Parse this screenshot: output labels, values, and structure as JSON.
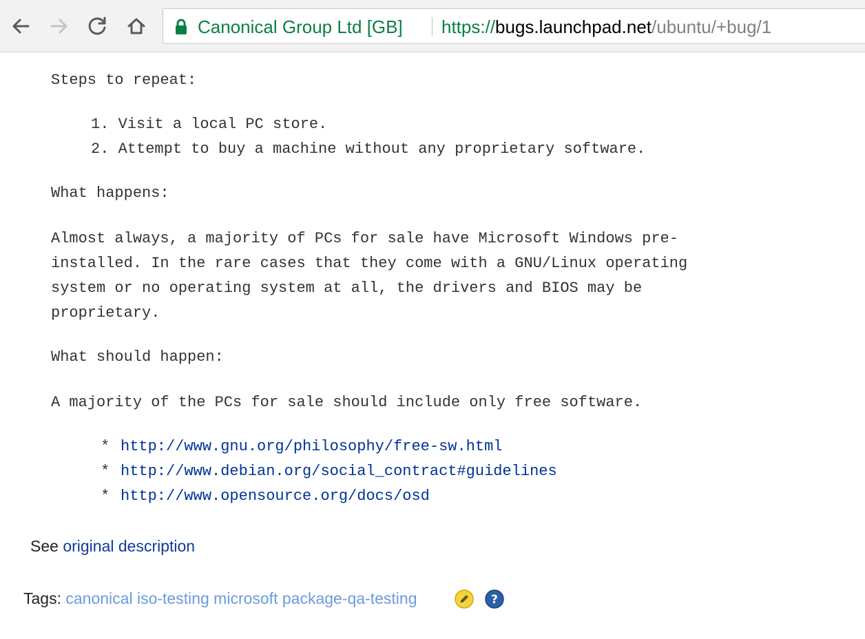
{
  "browser": {
    "cert_label": "Canonical Group Ltd [GB]",
    "url_scheme": "https://",
    "url_host": "bugs.launchpad.net",
    "url_path": "/ubuntu/+bug/1",
    "colors": {
      "secure": "#0b8043",
      "toolbar": "#f2f2f2"
    }
  },
  "description": {
    "steps_heading": "Steps to repeat:",
    "steps": [
      "1. Visit a local PC store.",
      "2. Attempt to buy a machine without any proprietary software."
    ],
    "what_happens_heading": "What happens:",
    "what_happens_lines": [
      "Almost always, a majority of PCs for sale have Microsoft Windows pre-",
      "installed. In the rare cases that they come with a GNU/Linux operating",
      "system or no operating system at all, the drivers and BIOS may be",
      "proprietary."
    ],
    "what_should_heading": "What should happen:",
    "what_should_text": "A majority of the PCs for sale should include only free software.",
    "bullet": "*",
    "links": [
      "http://www.gnu.org/philosophy/free-sw.html",
      "http://www.debian.org/social_contract#guidelines",
      "http://www.opensource.org/docs/osd"
    ]
  },
  "see_original": {
    "prefix": "See",
    "link": "original description"
  },
  "tags": {
    "label": "Tags:",
    "items": [
      "canonical",
      "iso-testing",
      "microsoft",
      "package-qa-testing"
    ]
  },
  "icons": {
    "back": "arrow-left-icon",
    "forward": "arrow-right-icon",
    "reload": "reload-icon",
    "home": "home-icon",
    "lock": "lock-icon",
    "edit": "pencil-edit-icon",
    "help": "question-help-icon"
  }
}
